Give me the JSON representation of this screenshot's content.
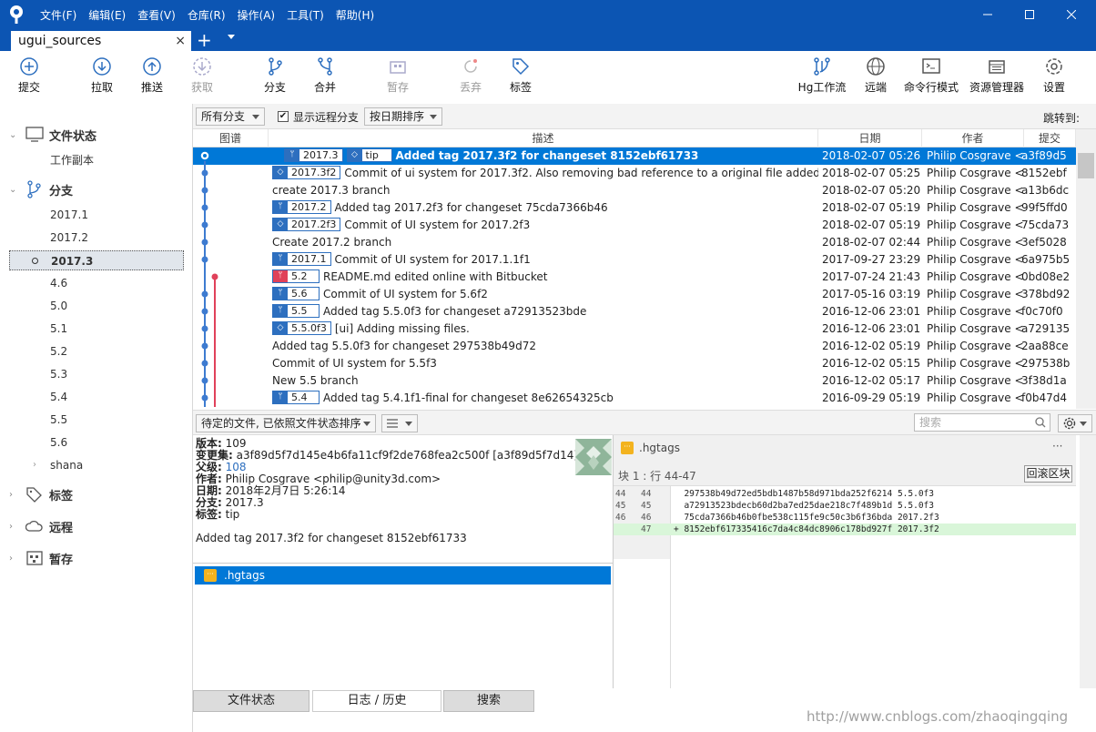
{
  "menu": [
    "文件(F)",
    "编辑(E)",
    "查看(V)",
    "仓库(R)",
    "操作(A)",
    "工具(T)",
    "帮助(H)"
  ],
  "tab": {
    "title": "ugui_sources",
    "close": "×",
    "add": "+"
  },
  "toolbar": {
    "commit": "提交",
    "pull": "拉取",
    "push": "推送",
    "fetch": "获取",
    "branch": "分支",
    "merge": "合并",
    "stash": "暂存",
    "discard": "丢弃",
    "tag": "标签",
    "hgflow": "Hg工作流",
    "remote": "远端",
    "terminal": "命令行模式",
    "explorer": "资源管理器",
    "settings": "设置"
  },
  "sidebar": {
    "file_status": "文件状态",
    "working_copy": "工作副本",
    "branches": "分支",
    "branch_items": [
      "2017.1",
      "2017.2",
      "2017.3",
      "4.6",
      "5.0",
      "5.1",
      "5.2",
      "5.3",
      "5.4",
      "5.5",
      "5.6",
      "shana"
    ],
    "tags": "标签",
    "remotes": "远程",
    "stash": "暂存"
  },
  "filter": {
    "all_branches": "所有分支",
    "show_remote": "显示远程分支",
    "sort": "按日期排序",
    "jump": "跳转到:",
    "checked": "✔"
  },
  "columns": {
    "graph": "图谱",
    "desc": "描述",
    "date": "日期",
    "author": "作者",
    "commit": "提交"
  },
  "log": [
    {
      "badges": [
        {
          "t": "2017.3",
          "k": "branch"
        },
        {
          "t": "tip",
          "k": "tag"
        }
      ],
      "desc": "Added tag 2017.3f2 for changeset 8152ebf61733",
      "date": "2018-02-07 05:26",
      "author": "Philip Cosgrave <",
      "commit": "a3f89d5"
    },
    {
      "badges": [
        {
          "t": "2017.3f2",
          "k": "tag"
        }
      ],
      "desc": "Commit of ui system for 2017.3f2. Also removing bad reference to a original file added",
      "date": "2018-02-07 05:25",
      "author": "Philip Cosgrave <",
      "commit": "8152ebf"
    },
    {
      "badges": [],
      "desc": "create 2017.3 branch",
      "date": "2018-02-07 05:20",
      "author": "Philip Cosgrave <",
      "commit": "a13b6dc"
    },
    {
      "badges": [
        {
          "t": "2017.2",
          "k": "branch"
        }
      ],
      "desc": "Added tag 2017.2f3 for changeset 75cda7366b46",
      "date": "2018-02-07 05:19",
      "author": "Philip Cosgrave <",
      "commit": "99f5ffd0"
    },
    {
      "badges": [
        {
          "t": "2017.2f3",
          "k": "tag"
        }
      ],
      "desc": "Commit of UI system for 2017.2f3",
      "date": "2018-02-07 05:19",
      "author": "Philip Cosgrave <",
      "commit": "75cda73"
    },
    {
      "badges": [],
      "desc": "Create 2017.2 branch",
      "date": "2018-02-07 02:44",
      "author": "Philip Cosgrave <",
      "commit": "3ef5028"
    },
    {
      "badges": [
        {
          "t": "2017.1",
          "k": "branch"
        }
      ],
      "desc": "Commit of UI system for 2017.1.1f1",
      "date": "2017-09-27 23:29",
      "author": "Philip Cosgrave <",
      "commit": "6a975b5"
    },
    {
      "badges": [
        {
          "t": "5.2",
          "k": "branch-red"
        }
      ],
      "desc": "README.md edited online with Bitbucket",
      "date": "2017-07-24 21:43",
      "author": "Philip Cosgrave <",
      "commit": "0bd08e2"
    },
    {
      "badges": [
        {
          "t": "5.6",
          "k": "branch"
        }
      ],
      "desc": "Commit of UI system for 5.6f2",
      "date": "2017-05-16 03:19",
      "author": "Philip Cosgrave <",
      "commit": "378bd92"
    },
    {
      "badges": [
        {
          "t": "5.5",
          "k": "branch"
        }
      ],
      "desc": "Added tag 5.5.0f3  for changeset a72913523bde",
      "date": "2016-12-06 23:01",
      "author": "Philip Cosgrave <",
      "commit": "f0c70f0"
    },
    {
      "badges": [
        {
          "t": "5.5.0f3",
          "k": "tag"
        }
      ],
      "desc": "[ui] Adding missing files.",
      "date": "2016-12-06 23:01",
      "author": "Philip Cosgrave <",
      "commit": "a729135"
    },
    {
      "badges": [],
      "desc": "Added tag 5.5.0f3 for changeset 297538b49d72",
      "date": "2016-12-02 05:19",
      "author": "Philip Cosgrave <",
      "commit": "2aa88ce"
    },
    {
      "badges": [],
      "desc": "Commit of UI system for 5.5f3",
      "date": "2016-12-02 05:15",
      "author": "Philip Cosgrave <",
      "commit": "297538b"
    },
    {
      "badges": [],
      "desc": "New 5.5 branch",
      "date": "2016-12-02 05:17",
      "author": "Philip Cosgrave <",
      "commit": "3f38d1a"
    },
    {
      "badges": [
        {
          "t": "5.4",
          "k": "branch"
        }
      ],
      "desc": "Added tag 5.4.1f1-final for changeset 8e62654325cb",
      "date": "2016-09-29 05:19",
      "author": "Philip Cosgrave <",
      "commit": "f0b47d4"
    }
  ],
  "lowbar": {
    "pending_sort": "待定的文件, 已依照文件状态排序",
    "search_placeholder": "搜索"
  },
  "details": [
    {
      "k": "版本:",
      "v": " 109"
    },
    {
      "k": "变更集:",
      "v": " a3f89d5f7d145e4b6fa11cf9f2de768fea2c500f [a3f89d5f7d14]"
    },
    {
      "k": "父级:",
      "v": " 108",
      "link": true
    },
    {
      "k": "作者:",
      "v": " Philip Cosgrave <philip@unity3d.com>"
    },
    {
      "k": "日期:",
      "v": " 2018年2月7日 5:26:14"
    },
    {
      "k": "分支:",
      "v": " 2017.3"
    },
    {
      "k": "标签:",
      "v": " tip"
    }
  ],
  "message": "Added tag 2017.3f2 for changeset 8152ebf61733",
  "file": ".hgtags",
  "diff": {
    "file": ".hgtags",
    "hunk": "块 1 :  行 44-47",
    "revert": "回滚区块",
    "more": "···",
    "lines": [
      {
        "n1": "44",
        "n2": "44",
        "t": "  297538b49d72ed5bdb1487b58d971bda252f6214 5.5.0f3",
        "add": false
      },
      {
        "n1": "45",
        "n2": "45",
        "t": "  a72913523bdecb60d2ba7ed25dae218c7f489b1d 5.5.0f3",
        "add": false
      },
      {
        "n1": "46",
        "n2": "46",
        "t": "  75cda7366b46b0fbe538c115fe9c50c3b6f36bda 2017.2f3",
        "add": false
      },
      {
        "n1": "",
        "n2": "47",
        "t": "+ 8152ebf617335416c7da4c84dc8906c178bd927f 2017.3f2",
        "add": true
      }
    ]
  },
  "bottom_tabs": [
    "文件状态",
    "日志 / 历史",
    "搜索"
  ],
  "watermark": "http://www.cnblogs.com/zhaoqingqing",
  "colors": {
    "titlebar": "#0c55b3",
    "selection": "#0078d7",
    "branch_badge": "#2d6fbf",
    "branch_red": "#e0415a",
    "graph_line": "#3d7bd0"
  }
}
